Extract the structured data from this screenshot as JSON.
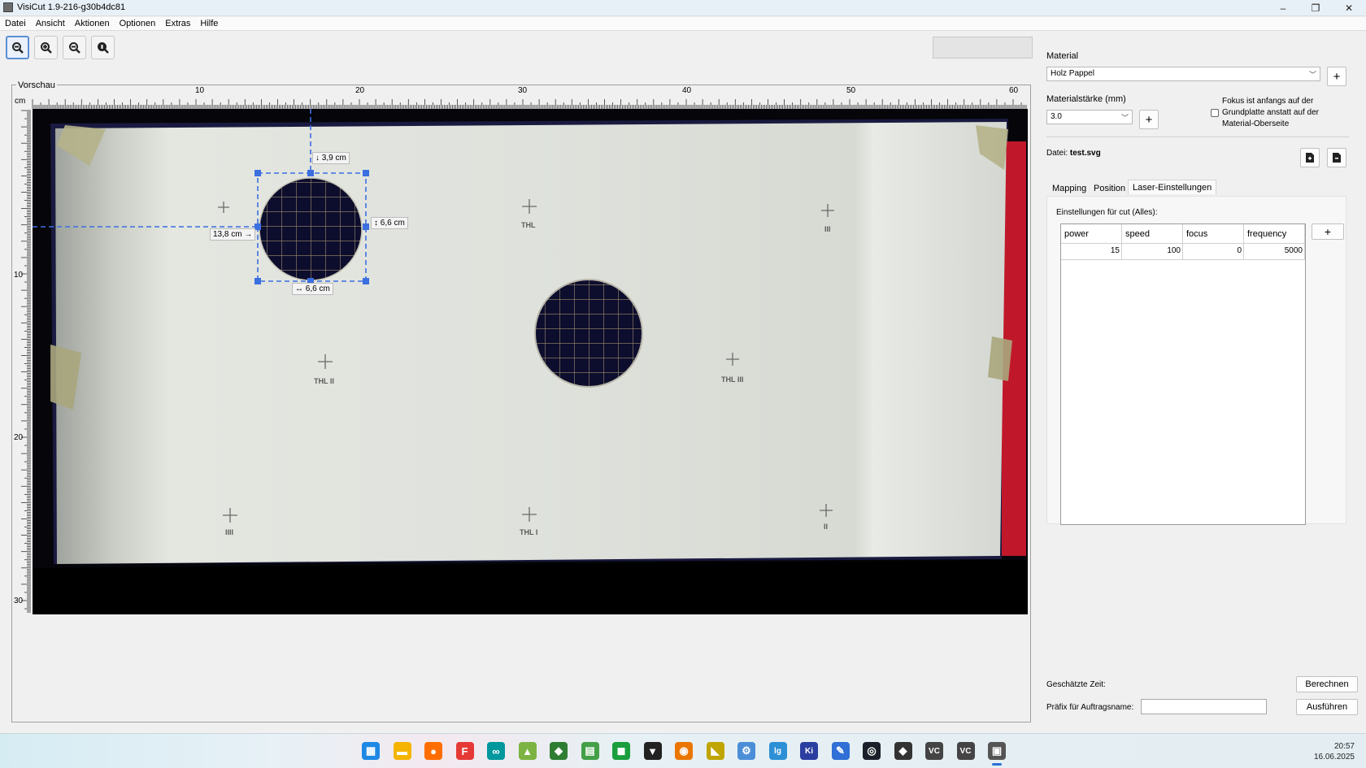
{
  "window": {
    "title": "VisiCut 1.9-216-g30b4dc81",
    "controls": [
      "–",
      "❐",
      "✕"
    ]
  },
  "menu": [
    "Datei",
    "Ansicht",
    "Aktionen",
    "Optionen",
    "Extras",
    "Hilfe"
  ],
  "toolbar": {
    "buttons": [
      {
        "name": "zoom-fit-icon",
        "selected": true
      },
      {
        "name": "zoom-in-icon",
        "selected": false
      },
      {
        "name": "zoom-out-icon",
        "selected": false
      },
      {
        "name": "zoom-reset-icon",
        "selected": false
      }
    ]
  },
  "preview": {
    "label": "Vorschau",
    "ruler_unit": "cm",
    "ruler_top_labels": [
      "10",
      "20",
      "30",
      "40",
      "50",
      "60"
    ],
    "ruler_left_labels": [
      "10",
      "20",
      "30"
    ],
    "dimensions": {
      "top_offset": "↓ 3,9 cm",
      "left_offset": "13,8 cm →",
      "height": "↕ 6,6 cm",
      "width": "↔ 6,6 cm"
    },
    "marks": [
      "THL",
      "III",
      "THL II",
      "THL III",
      "IIII",
      "THL I",
      "II"
    ]
  },
  "right_panel": {
    "material_label": "Material",
    "material_value": "Holz Pappel",
    "thickness_label": "Materialstärke (mm)",
    "thickness_value": "3.0",
    "focus_checkbox_label": "Fokus ist anfangs auf der Grundplatte anstatt auf der Material-Oberseite",
    "focus_checked": false,
    "file_label": "Datei:",
    "file_name": "test.svg",
    "tabs": [
      "Mapping",
      "Position",
      "Laser-Einstellungen"
    ],
    "active_tab": "Laser-Einstellungen",
    "settings_title": "Einstellungen für cut (Alles):",
    "table": {
      "columns": [
        "power",
        "speed",
        "focus",
        "frequency"
      ],
      "rows": [
        [
          "15",
          "100",
          "0",
          "5000"
        ]
      ]
    },
    "estimated_time_label": "Geschätzte Zeit:",
    "calculate_button": "Berechnen",
    "prefix_label": "Präfix für Auftragsname:",
    "prefix_value": "",
    "execute_button": "Ausführen",
    "add_symbol": "+"
  },
  "taskbar": {
    "icons": [
      {
        "name": "windows-start-icon",
        "color": "#1e88e5",
        "glyph": "▦"
      },
      {
        "name": "file-explorer-icon",
        "color": "#f4b400",
        "glyph": "▬"
      },
      {
        "name": "firefox-icon",
        "color": "#ff6d00",
        "glyph": "●"
      },
      {
        "name": "freecad-icon",
        "color": "#e53935",
        "glyph": "F"
      },
      {
        "name": "arduino-icon",
        "color": "#00979d",
        "glyph": "∞"
      },
      {
        "name": "image-viewer-icon",
        "color": "#7cb342",
        "glyph": "▲"
      },
      {
        "name": "notes-icon",
        "color": "#2e7d32",
        "glyph": "◆"
      },
      {
        "name": "spreadsheet-icon",
        "color": "#43a047",
        "glyph": "▤"
      },
      {
        "name": "green-app-icon",
        "color": "#1b9e3e",
        "glyph": "◼"
      },
      {
        "name": "inkscape-icon",
        "color": "#222222",
        "glyph": "▼"
      },
      {
        "name": "blender-icon",
        "color": "#ea7600",
        "glyph": "◉"
      },
      {
        "name": "tool-icon",
        "color": "#c0a400",
        "glyph": "◣"
      },
      {
        "name": "vscode-icon",
        "color": "#4b8ed8",
        "glyph": "⚙"
      },
      {
        "name": "lg-icon",
        "color": "#2d8fd5",
        "glyph": "lg"
      },
      {
        "name": "kicad-icon",
        "color": "#2b3ea0",
        "glyph": "Ki"
      },
      {
        "name": "pen-app-icon",
        "color": "#2f6fd6",
        "glyph": "✎"
      },
      {
        "name": "obs-icon",
        "color": "#1b1f2a",
        "glyph": "◎"
      },
      {
        "name": "cura-icon",
        "color": "#333333",
        "glyph": "◆"
      },
      {
        "name": "vc-app-icon",
        "color": "#444444",
        "glyph": "VC"
      },
      {
        "name": "vc-app-2-icon",
        "color": "#444444",
        "glyph": "VC"
      },
      {
        "name": "visicut-icon",
        "color": "#555555",
        "glyph": "▣"
      }
    ],
    "time": "20:57",
    "date": "16.06.2025"
  },
  "colors": {
    "selection": "#3b6fe0",
    "table_border": "#9a9a9a",
    "laser_bed_red": "#c0182a"
  }
}
